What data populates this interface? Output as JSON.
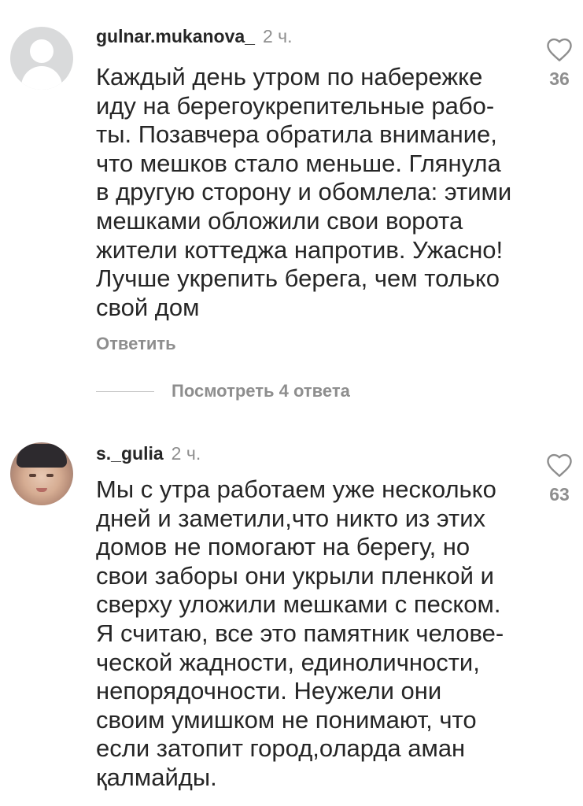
{
  "comments": [
    {
      "username": "gulnar.mukanova_",
      "time": "2 ч.",
      "text": "Каждый день утром по набережке\nиду на берегоукрепительные рабо-\nты. Позавчера обратила внимание,\nчто мешков стало меньше. Глянула\nв другую сторону и обомлела: этими\nмешками обложили свои ворота\nжители коттеджа напротив. Ужасно!\nЛучше укрепить берега, чем только\nсвой дом",
      "likes": "36",
      "reply_label": "Ответить",
      "view_replies": "Посмотреть 4 ответа"
    },
    {
      "username": "s._gulia",
      "time": "2 ч.",
      "text": "Мы с утра работаем уже несколько\nдней и заметили,что никто из этих\nдомов не помогают на берегу, но\nсвои заборы  они  укрыли пленкой и\nсверху уложили мешками с песком.\nЯ считаю, все это памятник челове-\nческой жадности, единоличности,\nнепорядочности. Неужели они\nсвоим умишком не понимают, что\nесли затопит город,оларда аман\nқалмайды.",
      "likes": "63"
    }
  ],
  "colors": {
    "text": "#262626",
    "secondary": "#8e8e8e",
    "divider": "#c7c7c7"
  },
  "icons": {
    "like": "heart-outline-icon"
  }
}
